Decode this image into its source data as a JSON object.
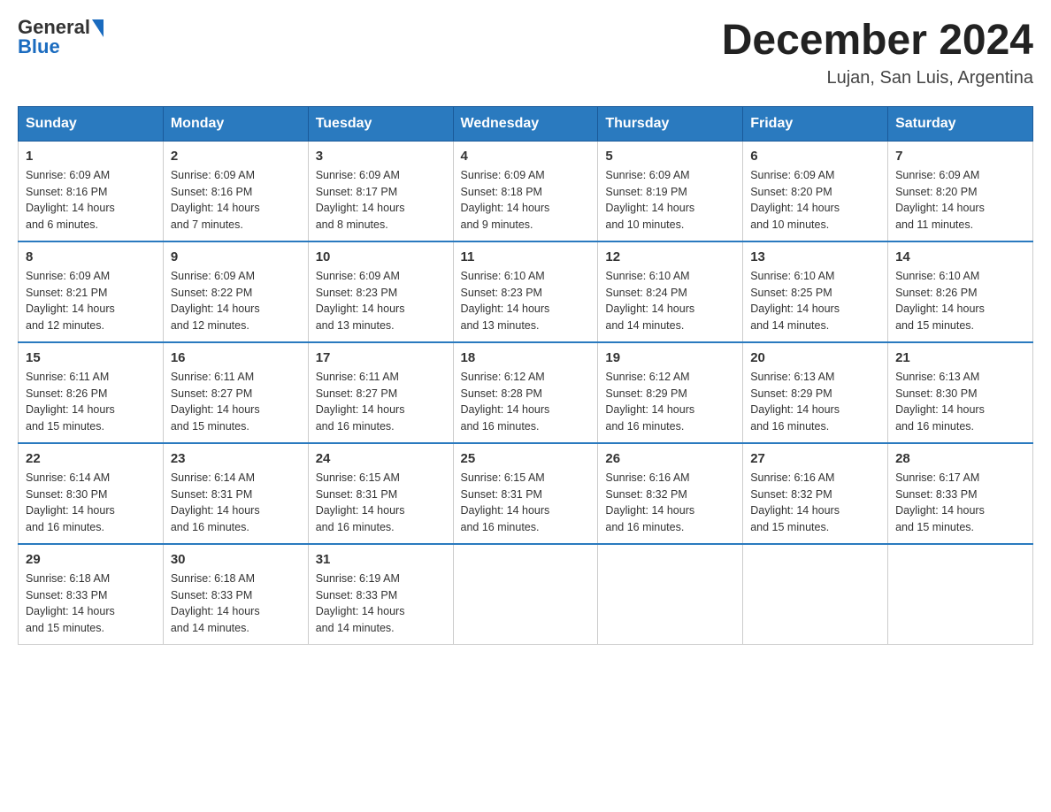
{
  "logo": {
    "general": "General",
    "blue": "Blue"
  },
  "title": {
    "month_year": "December 2024",
    "location": "Lujan, San Luis, Argentina"
  },
  "headers": [
    "Sunday",
    "Monday",
    "Tuesday",
    "Wednesday",
    "Thursday",
    "Friday",
    "Saturday"
  ],
  "weeks": [
    [
      {
        "day": "1",
        "sunrise": "6:09 AM",
        "sunset": "8:16 PM",
        "daylight": "14 hours and 6 minutes."
      },
      {
        "day": "2",
        "sunrise": "6:09 AM",
        "sunset": "8:16 PM",
        "daylight": "14 hours and 7 minutes."
      },
      {
        "day": "3",
        "sunrise": "6:09 AM",
        "sunset": "8:17 PM",
        "daylight": "14 hours and 8 minutes."
      },
      {
        "day": "4",
        "sunrise": "6:09 AM",
        "sunset": "8:18 PM",
        "daylight": "14 hours and 9 minutes."
      },
      {
        "day": "5",
        "sunrise": "6:09 AM",
        "sunset": "8:19 PM",
        "daylight": "14 hours and 10 minutes."
      },
      {
        "day": "6",
        "sunrise": "6:09 AM",
        "sunset": "8:20 PM",
        "daylight": "14 hours and 10 minutes."
      },
      {
        "day": "7",
        "sunrise": "6:09 AM",
        "sunset": "8:20 PM",
        "daylight": "14 hours and 11 minutes."
      }
    ],
    [
      {
        "day": "8",
        "sunrise": "6:09 AM",
        "sunset": "8:21 PM",
        "daylight": "14 hours and 12 minutes."
      },
      {
        "day": "9",
        "sunrise": "6:09 AM",
        "sunset": "8:22 PM",
        "daylight": "14 hours and 12 minutes."
      },
      {
        "day": "10",
        "sunrise": "6:09 AM",
        "sunset": "8:23 PM",
        "daylight": "14 hours and 13 minutes."
      },
      {
        "day": "11",
        "sunrise": "6:10 AM",
        "sunset": "8:23 PM",
        "daylight": "14 hours and 13 minutes."
      },
      {
        "day": "12",
        "sunrise": "6:10 AM",
        "sunset": "8:24 PM",
        "daylight": "14 hours and 14 minutes."
      },
      {
        "day": "13",
        "sunrise": "6:10 AM",
        "sunset": "8:25 PM",
        "daylight": "14 hours and 14 minutes."
      },
      {
        "day": "14",
        "sunrise": "6:10 AM",
        "sunset": "8:26 PM",
        "daylight": "14 hours and 15 minutes."
      }
    ],
    [
      {
        "day": "15",
        "sunrise": "6:11 AM",
        "sunset": "8:26 PM",
        "daylight": "14 hours and 15 minutes."
      },
      {
        "day": "16",
        "sunrise": "6:11 AM",
        "sunset": "8:27 PM",
        "daylight": "14 hours and 15 minutes."
      },
      {
        "day": "17",
        "sunrise": "6:11 AM",
        "sunset": "8:27 PM",
        "daylight": "14 hours and 16 minutes."
      },
      {
        "day": "18",
        "sunrise": "6:12 AM",
        "sunset": "8:28 PM",
        "daylight": "14 hours and 16 minutes."
      },
      {
        "day": "19",
        "sunrise": "6:12 AM",
        "sunset": "8:29 PM",
        "daylight": "14 hours and 16 minutes."
      },
      {
        "day": "20",
        "sunrise": "6:13 AM",
        "sunset": "8:29 PM",
        "daylight": "14 hours and 16 minutes."
      },
      {
        "day": "21",
        "sunrise": "6:13 AM",
        "sunset": "8:30 PM",
        "daylight": "14 hours and 16 minutes."
      }
    ],
    [
      {
        "day": "22",
        "sunrise": "6:14 AM",
        "sunset": "8:30 PM",
        "daylight": "14 hours and 16 minutes."
      },
      {
        "day": "23",
        "sunrise": "6:14 AM",
        "sunset": "8:31 PM",
        "daylight": "14 hours and 16 minutes."
      },
      {
        "day": "24",
        "sunrise": "6:15 AM",
        "sunset": "8:31 PM",
        "daylight": "14 hours and 16 minutes."
      },
      {
        "day": "25",
        "sunrise": "6:15 AM",
        "sunset": "8:31 PM",
        "daylight": "14 hours and 16 minutes."
      },
      {
        "day": "26",
        "sunrise": "6:16 AM",
        "sunset": "8:32 PM",
        "daylight": "14 hours and 16 minutes."
      },
      {
        "day": "27",
        "sunrise": "6:16 AM",
        "sunset": "8:32 PM",
        "daylight": "14 hours and 15 minutes."
      },
      {
        "day": "28",
        "sunrise": "6:17 AM",
        "sunset": "8:33 PM",
        "daylight": "14 hours and 15 minutes."
      }
    ],
    [
      {
        "day": "29",
        "sunrise": "6:18 AM",
        "sunset": "8:33 PM",
        "daylight": "14 hours and 15 minutes."
      },
      {
        "day": "30",
        "sunrise": "6:18 AM",
        "sunset": "8:33 PM",
        "daylight": "14 hours and 14 minutes."
      },
      {
        "day": "31",
        "sunrise": "6:19 AM",
        "sunset": "8:33 PM",
        "daylight": "14 hours and 14 minutes."
      },
      null,
      null,
      null,
      null
    ]
  ],
  "labels": {
    "sunrise": "Sunrise:",
    "sunset": "Sunset:",
    "daylight": "Daylight:"
  }
}
